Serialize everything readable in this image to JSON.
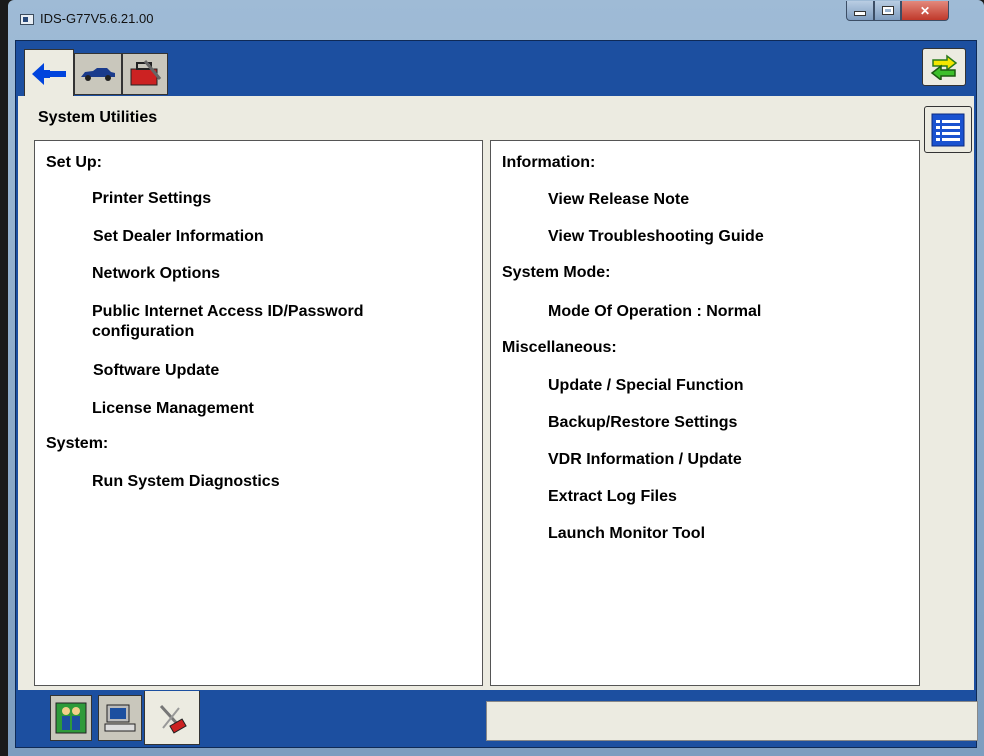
{
  "window": {
    "title": "IDS-G77V5.6.21.00"
  },
  "toolbar": {
    "tabs": [
      {
        "icon": "connect-arrow-icon",
        "active": true
      },
      {
        "icon": "vehicle-icon",
        "active": false
      },
      {
        "icon": "toolbox-icon",
        "active": false
      }
    ],
    "swap_icon": "swap-arrows-icon"
  },
  "page": {
    "title": "System Utilities",
    "list_icon": "list-menu-icon"
  },
  "left_column": {
    "sections": [
      {
        "heading": "Set Up:",
        "items": [
          "Printer Settings",
          "Set Dealer Information",
          "Network Options",
          "Public Internet Access ID/Password configuration",
          "Software Update",
          "License Management"
        ]
      },
      {
        "heading": "System:",
        "items": [
          "Run System Diagnostics"
        ]
      }
    ]
  },
  "right_column": {
    "sections": [
      {
        "heading": "Information:",
        "items": [
          "View Release Note",
          "View Troubleshooting Guide"
        ]
      },
      {
        "heading": "System Mode:",
        "items": [
          "Mode Of Operation : Normal"
        ]
      },
      {
        "heading": "Miscellaneous:",
        "items": [
          "Update / Special Function",
          "Backup/Restore Settings",
          "VDR Information / Update",
          "Extract Log Files",
          "Launch Monitor Tool"
        ]
      }
    ]
  },
  "bottom_tabs": [
    {
      "icon": "people-icon",
      "active": false
    },
    {
      "icon": "computer-icon",
      "active": false
    },
    {
      "icon": "tools-icon",
      "active": true
    }
  ],
  "status_bar": {
    "text": ""
  },
  "colors": {
    "frame_blue": "#1c4fa0",
    "panel": "#ecebe1",
    "accent_blue": "#0044dd"
  }
}
